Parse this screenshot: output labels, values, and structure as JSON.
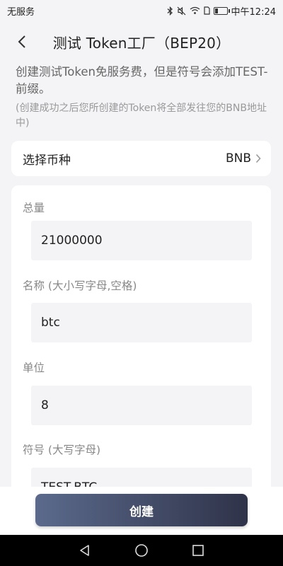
{
  "status_bar": {
    "carrier": "无服务",
    "time": "中午12:24",
    "icons": [
      "bluetooth-icon",
      "mute-icon",
      "wifi-icon",
      "sim-icon",
      "battery-icon"
    ],
    "battery_level": 0.2
  },
  "header": {
    "title": "测试 Token工厂（BEP20）",
    "back_icon": "chevron-left-icon"
  },
  "description": "创建测试Token免服务费，但是符号会添加TEST-前缀。",
  "note": "(创建成功之后您所创建的Token将全部发往您的BNB地址中)",
  "coin_select": {
    "label": "选择币种",
    "value": "BNB",
    "icon": "chevron-right-icon"
  },
  "form": {
    "fields": [
      {
        "label": "总量",
        "value": "21000000"
      },
      {
        "label": "名称 (大小写字母,空格)",
        "value": "btc"
      },
      {
        "label": "单位",
        "value": "8"
      },
      {
        "label": "符号 (大写字母)",
        "value": "TEST-BTC"
      }
    ]
  },
  "create_button": {
    "label": "创建",
    "gradient": [
      "#5b6a8c",
      "#2f3349"
    ]
  },
  "nav_bar": {
    "icons": [
      "back-triangle-icon",
      "home-circle-icon",
      "recents-square-icon"
    ]
  }
}
